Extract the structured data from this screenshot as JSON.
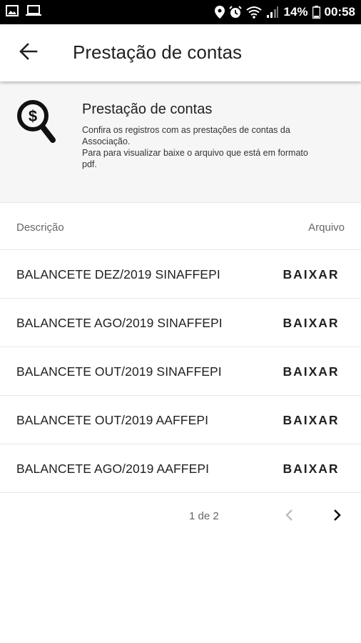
{
  "status_bar": {
    "battery": "14%",
    "time": "00:58",
    "icons": [
      "image-icon",
      "laptop-icon",
      "location-icon",
      "alarm-icon",
      "wifi-icon",
      "signal-icon",
      "battery-icon"
    ]
  },
  "app_bar": {
    "title": "Prestação de contas",
    "back_icon": "arrow-back-icon"
  },
  "info": {
    "icon": "money-search-icon",
    "title": "Prestação de contas",
    "line1": "Confira os registros com as prestações de contas da Associação.",
    "line2": "Para para visualizar baixe o arquivo que está em formato pdf."
  },
  "table": {
    "headers": {
      "description": "Descrição",
      "file": "Arquivo"
    },
    "rows": [
      {
        "description": "BALANCETE DEZ/2019 SINAFFEPI",
        "action": "BAIXAR"
      },
      {
        "description": "BALANCETE AGO/2019 SINAFFEPI",
        "action": "BAIXAR"
      },
      {
        "description": "BALANCETE OUT/2019 SINAFFEPI",
        "action": "BAIXAR"
      },
      {
        "description": "BALANCETE OUT/2019 AAFFEPI",
        "action": "BAIXAR"
      },
      {
        "description": "BALANCETE AGO/2019 AAFFEPI",
        "action": "BAIXAR"
      }
    ]
  },
  "pagination": {
    "label": "1 de 2",
    "prev_icon": "chevron-left-icon",
    "next_icon": "chevron-right-icon"
  },
  "colors": {
    "status_bar": "#000000",
    "card_bg": "#f6f6f6",
    "text": "#212121",
    "muted": "#666666",
    "disabled": "#bdbdbd"
  }
}
